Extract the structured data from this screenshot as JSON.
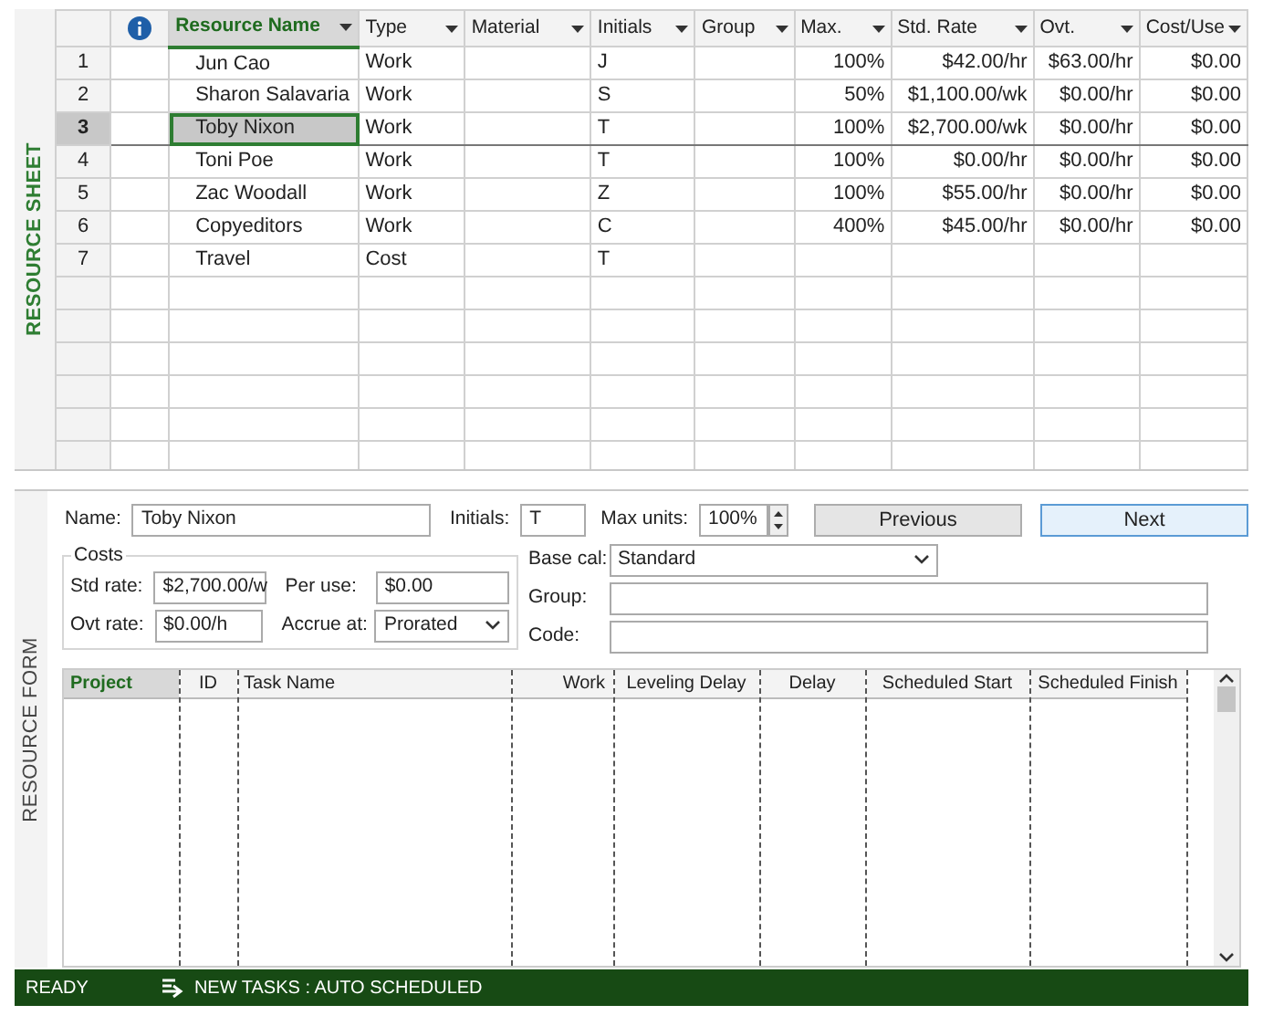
{
  "sheet": {
    "side_label": "RESOURCE SHEET",
    "columns": [
      {
        "kind": "info"
      },
      {
        "label": "Resource Name",
        "kind": "text",
        "selected": true
      },
      {
        "label": "Type",
        "kind": "text",
        "selected": false
      },
      {
        "label": "Material",
        "kind": "text",
        "selected": false
      },
      {
        "label": "Initials",
        "kind": "text",
        "selected": false
      },
      {
        "label": "Group",
        "kind": "text",
        "selected": false
      },
      {
        "label": "Max.",
        "kind": "number",
        "selected": false
      },
      {
        "label": "Std. Rate",
        "kind": "number",
        "selected": false
      },
      {
        "label": "Ovt.",
        "kind": "number",
        "selected": false
      },
      {
        "label": "Cost/Use",
        "kind": "number",
        "selected": false
      }
    ],
    "rows": [
      {
        "id": "1",
        "cells": [
          "",
          "Jun Cao",
          "Work",
          "",
          "J",
          "",
          "100%",
          "$42.00/hr",
          "$63.00/hr",
          "$0.00"
        ],
        "selected": false
      },
      {
        "id": "2",
        "cells": [
          "",
          "Sharon Salavaria",
          "Work",
          "",
          "S",
          "",
          "50%",
          "$1,100.00/wk",
          "$0.00/hr",
          "$0.00"
        ],
        "selected": false
      },
      {
        "id": "3",
        "cells": [
          "",
          "Toby Nixon",
          "Work",
          "",
          "T",
          "",
          "100%",
          "$2,700.00/wk",
          "$0.00/hr",
          "$0.00"
        ],
        "selected": true
      },
      {
        "id": "4",
        "cells": [
          "",
          "Toni Poe",
          "Work",
          "",
          "T",
          "",
          "100%",
          "$0.00/hr",
          "$0.00/hr",
          "$0.00"
        ],
        "selected": false
      },
      {
        "id": "5",
        "cells": [
          "",
          "Zac Woodall",
          "Work",
          "",
          "Z",
          "",
          "100%",
          "$55.00/hr",
          "$0.00/hr",
          "$0.00"
        ],
        "selected": false
      },
      {
        "id": "6",
        "cells": [
          "",
          "Copyeditors",
          "Work",
          "",
          "C",
          "",
          "400%",
          "$45.00/hr",
          "$0.00/hr",
          "$0.00"
        ],
        "selected": false
      },
      {
        "id": "7",
        "cells": [
          "",
          "Travel",
          "Cost",
          "",
          "T",
          "",
          "",
          "",
          "",
          ""
        ],
        "selected": false
      }
    ]
  },
  "form": {
    "side_label": "RESOURCE FORM",
    "name_label": "Name:",
    "name": "Toby Nixon",
    "initials_label": "Initials:",
    "initials": "T",
    "max_units_label": "Max units:",
    "max_units": "100%",
    "previous_button": "Previous",
    "next_button": "Next",
    "costs_title": "Costs",
    "std_rate_label": "Std rate:",
    "std_rate": "$2,700.00/w",
    "per_use_label": "Per use:",
    "per_use": "$0.00",
    "ovt_rate_label": "Ovt rate:",
    "ovt_rate": "$0.00/h",
    "accrue_label": "Accrue at:",
    "accrue": "Prorated",
    "base_cal_label": "Base cal:",
    "base_cal": "Standard",
    "group_label": "Group:",
    "code_label": "Code:",
    "columns": [
      {
        "label": "Project",
        "selected": true
      },
      {
        "label": "ID",
        "selected": false
      },
      {
        "label": "Task Name",
        "selected": false
      },
      {
        "label": "Work",
        "selected": false
      },
      {
        "label": "Leveling Delay",
        "selected": false
      },
      {
        "label": "Delay",
        "selected": false
      },
      {
        "label": "Scheduled Start",
        "selected": false
      },
      {
        "label": "Scheduled Finish",
        "selected": false
      }
    ]
  },
  "status_bar": {
    "mode": "READY",
    "new_tasks": "NEW TASKS : AUTO SCHEDULED"
  }
}
